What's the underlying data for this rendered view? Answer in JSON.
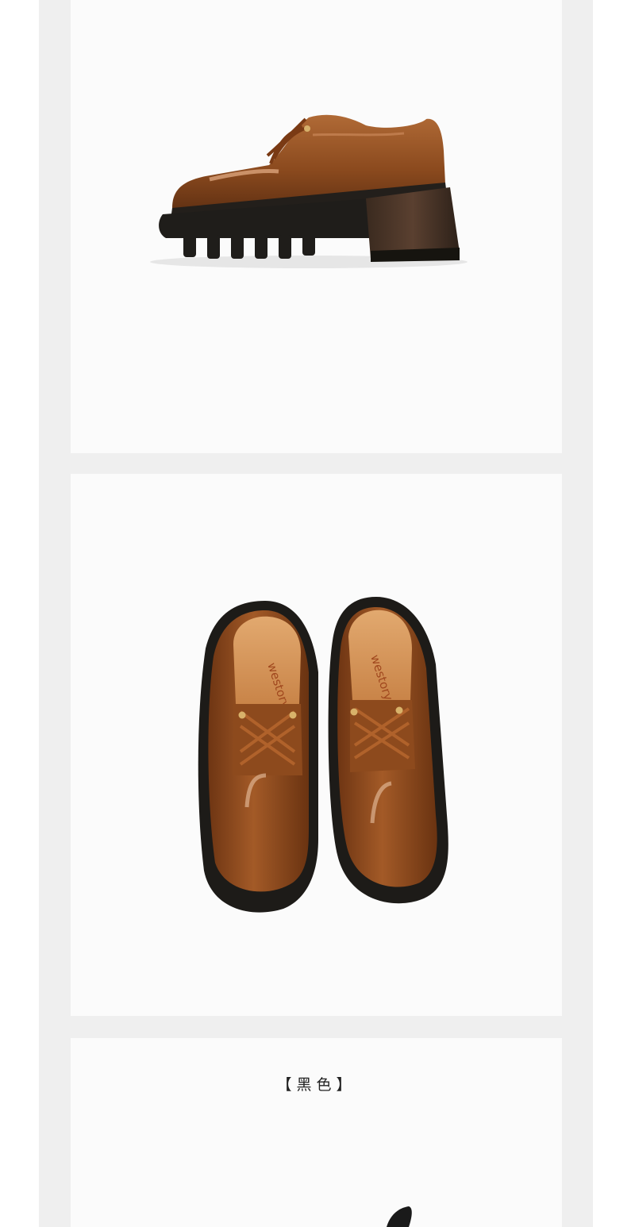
{
  "panels": [
    {
      "id": "panel-side-view",
      "image": "brown patent leather lace-up platform shoe, side view"
    },
    {
      "id": "panel-top-view",
      "image": "pair of brown patent leather shoes, top view",
      "insole_brand": "westory"
    },
    {
      "id": "panel-black-color",
      "label": "【黑色】"
    }
  ],
  "colors": {
    "frame": "#efefef",
    "panel": "#fbfbfb",
    "leather": "#8a4a1f",
    "sole": "#1b1a17"
  }
}
